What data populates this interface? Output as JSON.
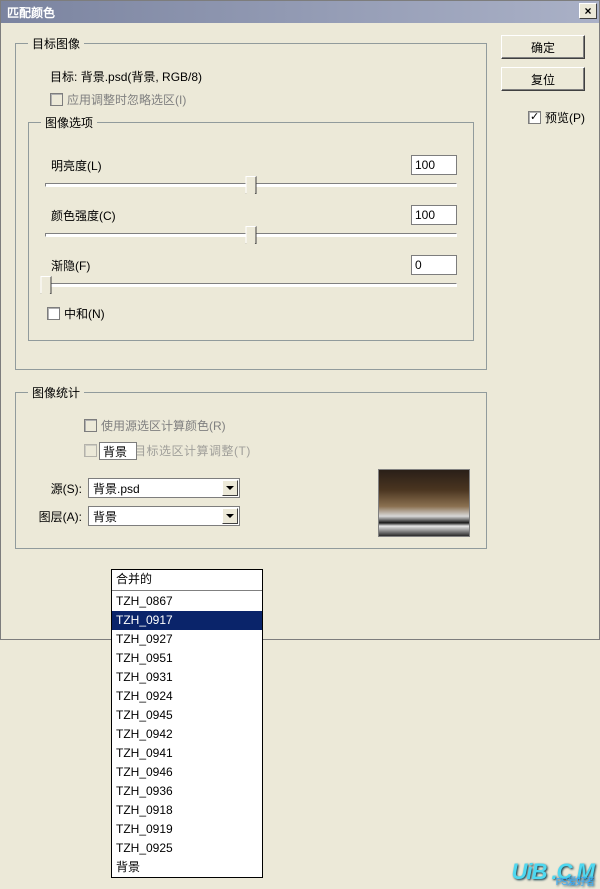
{
  "title": "匹配颜色",
  "close_x": "×",
  "buttons": {
    "ok": "确定",
    "reset": "复位"
  },
  "preview": {
    "label": "预览(P)",
    "checked": true
  },
  "target": {
    "legend": "目标图像",
    "target_label": "目标:",
    "target_value": "背景.psd(背景, RGB/8)",
    "ignore_checkbox": "应用调整时忽略选区(I)"
  },
  "options": {
    "legend": "图像选项",
    "luminance": {
      "label": "明亮度(L)",
      "value": "100",
      "pos": 50
    },
    "intensity": {
      "label": "颜色强度(C)",
      "value": "100",
      "pos": 50
    },
    "fade": {
      "label": "渐隐(F)",
      "value": "0",
      "pos": 0
    },
    "neutralize": "中和(N)"
  },
  "stats": {
    "legend": "图像统计",
    "use_selection_src": "使用源选区计算颜色(R)",
    "small_text": "背景",
    "truncated": "使用目标选区计算调整(T)",
    "source_label": "源(S):",
    "source_value": "背景.psd",
    "layer_label": "图层(A):",
    "layer_value": "背景"
  },
  "dropdown": {
    "merged": "合并的",
    "items": [
      "TZH_0867",
      "TZH_0917",
      "TZH_0927",
      "TZH_0951",
      "TZH_0931",
      "TZH_0924",
      "TZH_0945",
      "TZH_0942",
      "TZH_0941",
      "TZH_0946",
      "TZH_0936",
      "TZH_0918",
      "TZH_0919",
      "TZH_0925",
      "背景"
    ],
    "selected_index": 1
  },
  "watermark": "UiB   .C   M",
  "watermark_sub": "PS爱好者"
}
